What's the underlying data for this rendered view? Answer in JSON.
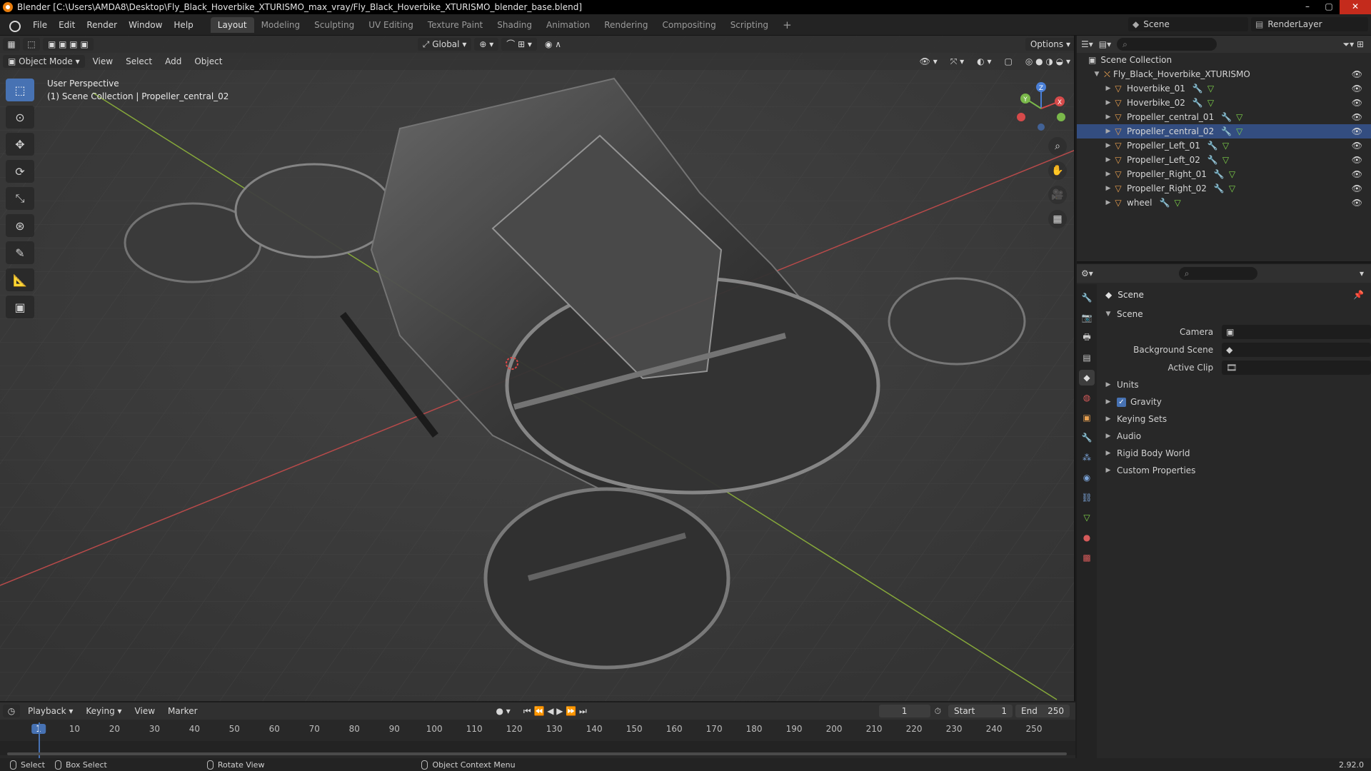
{
  "window": {
    "title": "Blender [C:\\Users\\AMDA8\\Desktop\\Fly_Black_Hoverbike_XTURISMO_max_vray/Fly_Black_Hoverbike_XTURISMO_blender_base.blend]"
  },
  "menu": [
    "File",
    "Edit",
    "Render",
    "Window",
    "Help"
  ],
  "workspaces": [
    "Layout",
    "Modeling",
    "Sculpting",
    "UV Editing",
    "Texture Paint",
    "Shading",
    "Animation",
    "Rendering",
    "Compositing",
    "Scripting"
  ],
  "active_workspace": "Layout",
  "scene_selector": "Scene",
  "layer_selector": "RenderLayer",
  "viewport": {
    "transform_orientation": "Global",
    "options_label": "Options",
    "mode": "Object Mode",
    "header_menu": [
      "View",
      "Select",
      "Add",
      "Object"
    ],
    "perspective_label": "User Perspective",
    "context_label": "(1) Scene Collection | Propeller_central_02"
  },
  "gizmo": {
    "x": "X",
    "y": "Y",
    "z": "Z"
  },
  "outliner": {
    "root": "Scene Collection",
    "collection": "Fly_Black_Hoverbike_XTURISMO",
    "objects": [
      "Hoverbike_01",
      "Hoverbike_02",
      "Propeller_central_01",
      "Propeller_central_02",
      "Propeller_Left_01",
      "Propeller_Left_02",
      "Propeller_Right_01",
      "Propeller_Right_02",
      "wheel"
    ],
    "active_object": "Propeller_central_02"
  },
  "properties": {
    "context_title": "Scene",
    "panel_title": "Scene",
    "fields": [
      {
        "label": "Camera",
        "value": ""
      },
      {
        "label": "Background Scene",
        "value": ""
      },
      {
        "label": "Active Clip",
        "value": ""
      }
    ],
    "subpanels": [
      "Units",
      "Gravity",
      "Keying Sets",
      "Audio",
      "Rigid Body World",
      "Custom Properties"
    ],
    "gravity_checked": true
  },
  "timeline": {
    "menus": [
      "Playback",
      "Keying",
      "View",
      "Marker"
    ],
    "current_frame": "1",
    "start_label": "Start",
    "start_value": "1",
    "end_label": "End",
    "end_value": "250",
    "ticks": [
      "1",
      "10",
      "20",
      "30",
      "40",
      "50",
      "60",
      "70",
      "80",
      "90",
      "100",
      "110",
      "120",
      "130",
      "140",
      "150",
      "160",
      "170",
      "180",
      "190",
      "200",
      "210",
      "220",
      "230",
      "240",
      "250"
    ]
  },
  "statusbar": {
    "select": "Select",
    "box_select": "Box Select",
    "rotate_view": "Rotate View",
    "context_menu": "Object Context Menu",
    "version": "2.92.0"
  }
}
